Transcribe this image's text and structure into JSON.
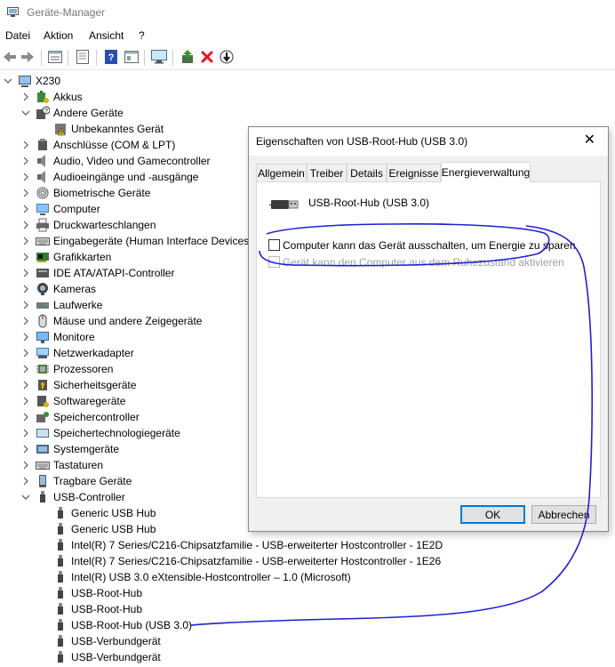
{
  "window": {
    "title": "Geräte-Manager",
    "icon": "device-manager-icon"
  },
  "menu": [
    "Datei",
    "Aktion",
    "Ansicht",
    "?"
  ],
  "toolbar": [
    "back-icon",
    "forward-icon",
    "properties-icon",
    "list-icon",
    "help-icon",
    "view-icon",
    "monitor-icon",
    "update-driver-icon",
    "uninstall-icon",
    "scan-hardware-icon"
  ],
  "tree": {
    "root": "X230",
    "categories": [
      {
        "label": "Akkus",
        "icon": "battery-icon",
        "expanded": false
      },
      {
        "label": "Andere Geräte",
        "icon": "unknown-device-icon",
        "expanded": true,
        "children": [
          {
            "label": "Unbekanntes Gerät",
            "icon": "warning-device-icon"
          }
        ]
      },
      {
        "label": "Anschlüsse (COM & LPT)",
        "icon": "port-icon",
        "expanded": false
      },
      {
        "label": "Audio, Video und Gamecontroller",
        "icon": "speaker-icon",
        "expanded": false
      },
      {
        "label": "Audioeingänge und -ausgänge",
        "icon": "speaker-icon",
        "expanded": false
      },
      {
        "label": "Biometrische Geräte",
        "icon": "fingerprint-icon",
        "expanded": false
      },
      {
        "label": "Computer",
        "icon": "computer-icon",
        "expanded": false
      },
      {
        "label": "Druckwarteschlangen",
        "icon": "printer-icon",
        "expanded": false
      },
      {
        "label": "Eingabegeräte (Human Interface Devices)",
        "icon": "keyboard-icon",
        "expanded": false
      },
      {
        "label": "Grafikkarten",
        "icon": "graphics-card-icon",
        "expanded": false
      },
      {
        "label": "IDE ATA/ATAPI-Controller",
        "icon": "ide-controller-icon",
        "expanded": false
      },
      {
        "label": "Kameras",
        "icon": "camera-icon",
        "expanded": false
      },
      {
        "label": "Laufwerke",
        "icon": "disk-drive-icon",
        "expanded": false
      },
      {
        "label": "Mäuse und andere Zeigegeräte",
        "icon": "mouse-icon",
        "expanded": false
      },
      {
        "label": "Monitore",
        "icon": "monitor-icon",
        "expanded": false
      },
      {
        "label": "Netzwerkadapter",
        "icon": "network-adapter-icon",
        "expanded": false
      },
      {
        "label": "Prozessoren",
        "icon": "processor-icon",
        "expanded": false
      },
      {
        "label": "Sicherheitsgeräte",
        "icon": "security-device-icon",
        "expanded": false
      },
      {
        "label": "Softwaregeräte",
        "icon": "software-device-icon",
        "expanded": false
      },
      {
        "label": "Speichercontroller",
        "icon": "storage-controller-icon",
        "expanded": false
      },
      {
        "label": "Speichertechnologiegeräte",
        "icon": "memory-technology-icon",
        "expanded": false
      },
      {
        "label": "Systemgeräte",
        "icon": "system-device-icon",
        "expanded": false
      },
      {
        "label": "Tastaturen",
        "icon": "keyboard-icon",
        "expanded": false
      },
      {
        "label": "Tragbare Geräte",
        "icon": "portable-device-icon",
        "expanded": false
      },
      {
        "label": "USB-Controller",
        "icon": "usb-icon",
        "expanded": true,
        "children": [
          {
            "label": "Generic USB Hub",
            "icon": "usb-icon"
          },
          {
            "label": "Generic USB Hub",
            "icon": "usb-icon"
          },
          {
            "label": "Intel(R) 7 Series/C216-Chipsatzfamilie - USB-erweiterter Hostcontroller - 1E2D",
            "icon": "usb-icon"
          },
          {
            "label": "Intel(R) 7 Series/C216-Chipsatzfamilie - USB-erweiterter Hostcontroller - 1E26",
            "icon": "usb-icon"
          },
          {
            "label": "Intel(R) USB 3.0 eXtensible-Hostcontroller – 1.0 (Microsoft)",
            "icon": "usb-icon"
          },
          {
            "label": "USB-Root-Hub",
            "icon": "usb-icon"
          },
          {
            "label": "USB-Root-Hub",
            "icon": "usb-icon"
          },
          {
            "label": "USB-Root-Hub (USB 3.0)",
            "icon": "usb-icon"
          },
          {
            "label": "USB-Verbundgerät",
            "icon": "usb-icon"
          },
          {
            "label": "USB-Verbundgerät",
            "icon": "usb-icon"
          }
        ]
      }
    ]
  },
  "dialog": {
    "title": "Eigenschaften von USB-Root-Hub (USB 3.0)",
    "tabs": [
      "Allgemein",
      "Treiber",
      "Details",
      "Ereignisse",
      "Energieverwaltung"
    ],
    "active_tab": "Energieverwaltung",
    "device_name": "USB-Root-Hub (USB 3.0)",
    "options": [
      {
        "label": "Computer kann das Gerät ausschalten, um Energie zu sparen",
        "checked": false,
        "enabled": true
      },
      {
        "label": "Gerät kann den Computer aus dem Ruhezustand aktivieren",
        "checked": false,
        "enabled": false
      }
    ],
    "ok_label": "OK",
    "cancel_label": "Abbrechen"
  },
  "colors": {
    "annotation_ink": "#1f1fd6",
    "accent": "#0078d7",
    "error_red": "#e81123"
  }
}
